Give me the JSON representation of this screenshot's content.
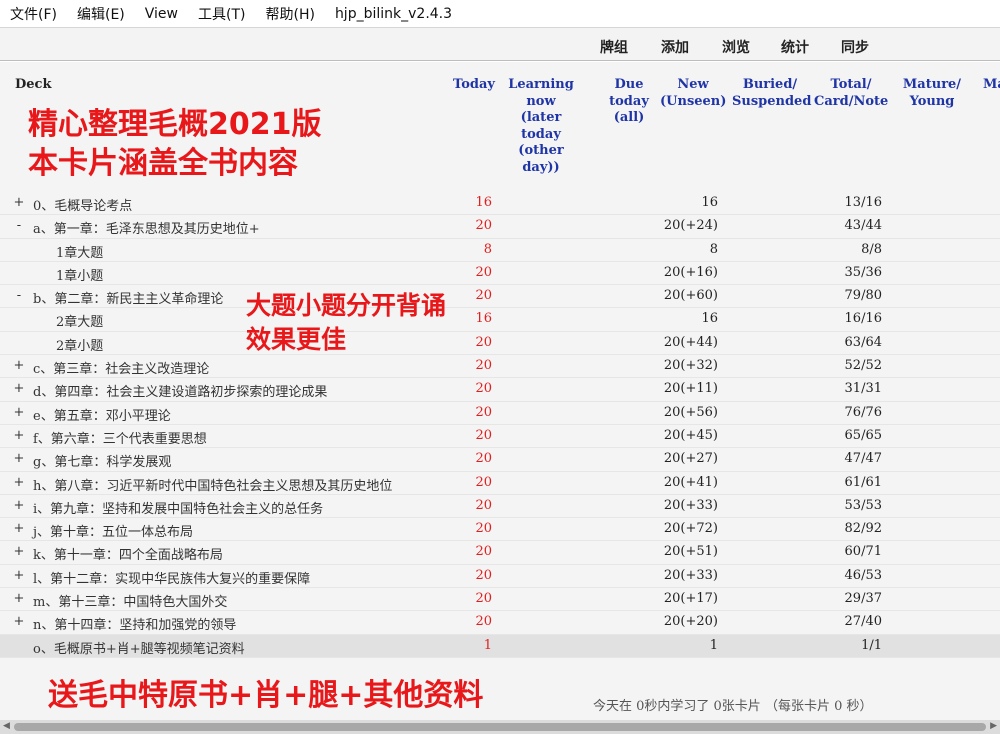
{
  "menu": {
    "items": [
      "文件(F)",
      "编辑(E)",
      "View",
      "工具(T)",
      "帮助(H)"
    ],
    "app_title": "hjp_bilink_v2.4.3"
  },
  "toolbar": {
    "items": [
      "牌组",
      "添加",
      "浏览",
      "统计",
      "同步"
    ]
  },
  "columns": {
    "deck": "Deck",
    "today": "Today",
    "learning": "Learning\nnow\n(later\ntoday\n(other\nday))",
    "due": "Due\ntoday\n(all)",
    "new": "New\n(Unseen)",
    "buried": "Buried/\nSuspended",
    "total": "Total/\nCard/Note",
    "mature": "Mature/\nYoung",
    "cutoff": "Ma"
  },
  "decks": [
    {
      "expander": "+",
      "name": "0、毛概导论考点",
      "indent": 0,
      "today": "16",
      "new": "16",
      "total": "13/16"
    },
    {
      "expander": "-",
      "name": "a、第一章：毛泽东思想及其历史地位+",
      "indent": 0,
      "today": "20",
      "new": "20(+24)",
      "total": "43/44"
    },
    {
      "expander": "",
      "name": "1章大题",
      "indent": 1,
      "today": "8",
      "new": "8",
      "total": "8/8"
    },
    {
      "expander": "",
      "name": "1章小题",
      "indent": 1,
      "today": "20",
      "new": "20(+16)",
      "total": "35/36"
    },
    {
      "expander": "-",
      "name": "b、第二章：新民主主义革命理论",
      "indent": 0,
      "today": "20",
      "new": "20(+60)",
      "total": "79/80"
    },
    {
      "expander": "",
      "name": "2章大题",
      "indent": 1,
      "today": "16",
      "new": "16",
      "total": "16/16"
    },
    {
      "expander": "",
      "name": "2章小题",
      "indent": 1,
      "today": "20",
      "new": "20(+44)",
      "total": "63/64"
    },
    {
      "expander": "+",
      "name": "c、第三章：社会主义改造理论",
      "indent": 0,
      "today": "20",
      "new": "20(+32)",
      "total": "52/52"
    },
    {
      "expander": "+",
      "name": "d、第四章：社会主义建设道路初步探索的理论成果",
      "indent": 0,
      "today": "20",
      "new": "20(+11)",
      "total": "31/31"
    },
    {
      "expander": "+",
      "name": "e、第五章：邓小平理论",
      "indent": 0,
      "today": "20",
      "new": "20(+56)",
      "total": "76/76"
    },
    {
      "expander": "+",
      "name": "f、第六章：三个代表重要思想",
      "indent": 0,
      "today": "20",
      "new": "20(+45)",
      "total": "65/65"
    },
    {
      "expander": "+",
      "name": "g、第七章：科学发展观",
      "indent": 0,
      "today": "20",
      "new": "20(+27)",
      "total": "47/47"
    },
    {
      "expander": "+",
      "name": "h、第八章：习近平新时代中国特色社会主义思想及其历史地位",
      "indent": 0,
      "today": "20",
      "new": "20(+41)",
      "total": "61/61"
    },
    {
      "expander": "+",
      "name": "i、第九章：坚持和发展中国特色社会主义的总任务",
      "indent": 0,
      "today": "20",
      "new": "20(+33)",
      "total": "53/53"
    },
    {
      "expander": "+",
      "name": "j、第十章：五位一体总布局",
      "indent": 0,
      "today": "20",
      "new": "20(+72)",
      "total": "82/92"
    },
    {
      "expander": "+",
      "name": "k、第十一章：四个全面战略布局",
      "indent": 0,
      "today": "20",
      "new": "20(+51)",
      "total": "60/71"
    },
    {
      "expander": "+",
      "name": "l、第十二章：实现中华民族伟大复兴的重要保障",
      "indent": 0,
      "today": "20",
      "new": "20(+33)",
      "total": "46/53"
    },
    {
      "expander": "+",
      "name": "m、第十三章：中国特色大国外交",
      "indent": 0,
      "today": "20",
      "new": "20(+17)",
      "total": "29/37"
    },
    {
      "expander": "+",
      "name": "n、第十四章：坚持和加强党的领导",
      "indent": 0,
      "today": "20",
      "new": "20(+20)",
      "total": "27/40"
    },
    {
      "expander": "",
      "name": "o、毛概原书+肖+腿等视频笔记资料",
      "indent": 0,
      "today": "1",
      "new": "1",
      "total": "1/1",
      "current": true
    }
  ],
  "promo": {
    "line1": "精心整理毛概2021版",
    "line2": "本卡片涵盖全书内容",
    "line3": "大题小题分开背诵",
    "line4": "效果更佳",
    "line5": "送毛中特原书+肖+腿+其他资料"
  },
  "footer": {
    "studied": "今天在 0秒内学习了 0张卡片 （每张卡片 0 秒）"
  },
  "colors": {
    "header_blue": "#1f35a6",
    "due_red": "#e02020",
    "promo_red": "#e8181a"
  }
}
